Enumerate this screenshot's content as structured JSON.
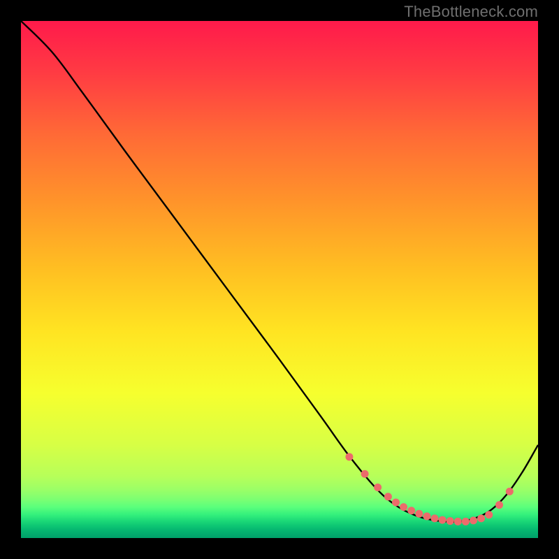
{
  "watermark": "TheBottleneck.com",
  "colors": {
    "bg_black": "#000000",
    "curve": "#000000",
    "marker_fill": "#ec6b6b",
    "marker_stroke": "#b34a4a",
    "gradient_stops": [
      {
        "o": 0.0,
        "c": "#ff1a4b"
      },
      {
        "o": 0.1,
        "c": "#ff3b43"
      },
      {
        "o": 0.22,
        "c": "#ff6a36"
      },
      {
        "o": 0.35,
        "c": "#ff942a"
      },
      {
        "o": 0.48,
        "c": "#ffbf22"
      },
      {
        "o": 0.6,
        "c": "#ffe422"
      },
      {
        "o": 0.72,
        "c": "#f6ff2e"
      },
      {
        "o": 0.82,
        "c": "#d7ff45"
      },
      {
        "o": 0.88,
        "c": "#b7ff59"
      },
      {
        "o": 0.905,
        "c": "#9dff66"
      },
      {
        "o": 0.925,
        "c": "#7cff72"
      },
      {
        "o": 0.94,
        "c": "#5bff7c"
      },
      {
        "o": 0.955,
        "c": "#33f07c"
      },
      {
        "o": 0.965,
        "c": "#1fdc78"
      },
      {
        "o": 0.975,
        "c": "#0fc974"
      },
      {
        "o": 0.985,
        "c": "#05b570"
      },
      {
        "o": 1.0,
        "c": "#00a06a"
      }
    ]
  },
  "chart_data": {
    "type": "line",
    "title": "",
    "xlabel": "",
    "ylabel": "",
    "xlim": [
      0,
      100
    ],
    "ylim": [
      0,
      100
    ],
    "grid": false,
    "legend": false,
    "series": [
      {
        "name": "bottleneck-curve",
        "x": [
          0,
          6,
          12,
          20,
          30,
          40,
          50,
          58,
          63,
          67,
          70,
          73,
          76,
          79,
          82,
          85,
          88,
          91,
          94,
          97,
          100
        ],
        "y": [
          100,
          94,
          86,
          75,
          61.5,
          48,
          34.5,
          23.5,
          16.5,
          11.5,
          8.3,
          6.0,
          4.5,
          3.6,
          3.2,
          3.2,
          3.9,
          5.5,
          8.5,
          12.8,
          18
        ]
      }
    ],
    "markers": {
      "name": "highlight-points",
      "x": [
        63.5,
        66.5,
        69,
        71,
        72.5,
        74,
        75.5,
        77,
        78.5,
        80,
        81.5,
        83,
        84.5,
        86,
        87.5,
        89,
        90.5,
        92.5,
        94.5
      ],
      "y": [
        15.7,
        12.4,
        9.8,
        8.0,
        6.9,
        6.0,
        5.3,
        4.7,
        4.2,
        3.8,
        3.5,
        3.3,
        3.2,
        3.2,
        3.4,
        3.8,
        4.5,
        6.4,
        9.0
      ]
    }
  }
}
